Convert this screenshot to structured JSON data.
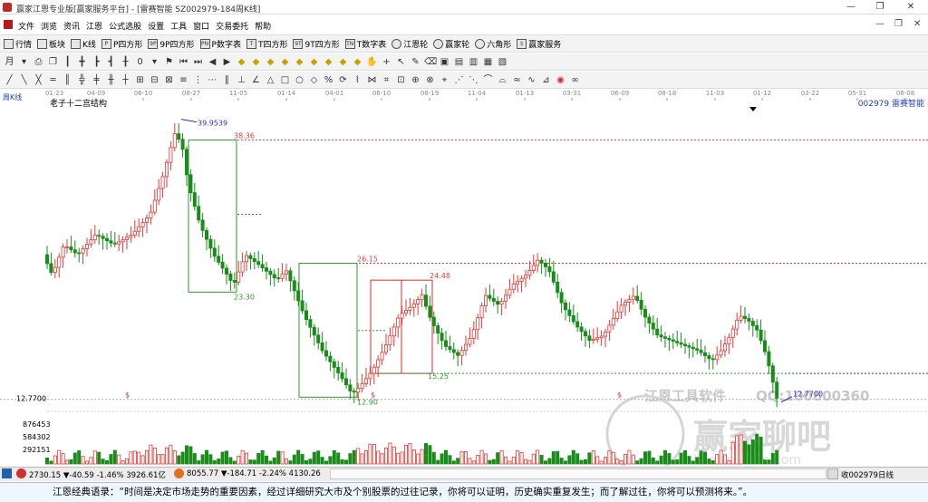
{
  "window": {
    "title": "赢家江恩专业版[赢家服务平台] - [雷赛智能  SZ002979-184周K线]",
    "buttons": [
      "—",
      "❐",
      "✕"
    ]
  },
  "menu": [
    "文件",
    "浏览",
    "资讯",
    "江恩",
    "公式选股",
    "设置",
    "工具",
    "窗口",
    "交易委托",
    "帮助"
  ],
  "mdi_buttons": [
    "—",
    "❐",
    "✕"
  ],
  "toolbar": [
    {
      "icon": "list-icon",
      "label": "行情"
    },
    {
      "icon": "grid-icon",
      "label": "板块"
    },
    {
      "icon": "candle-icon",
      "label": "K线"
    },
    {
      "icon": "square-icon",
      "label": "P四方形",
      "tag": "P"
    },
    {
      "icon": "square-icon",
      "label": "9P四方形",
      "tag": "9P"
    },
    {
      "icon": "square-icon",
      "label": "P数字表",
      "tag": "PN"
    },
    {
      "icon": "square-icon",
      "label": "T四方形",
      "tag": "T"
    },
    {
      "icon": "square-icon",
      "label": "9T四方形",
      "tag": "9T"
    },
    {
      "icon": "square-icon",
      "label": "T数字表",
      "tag": "TN"
    },
    {
      "icon": "wheel-icon",
      "label": "江恩轮"
    },
    {
      "icon": "wheel-icon",
      "label": "赢家轮"
    },
    {
      "icon": "hexagon-icon",
      "label": "六角形"
    },
    {
      "icon": "dollar-icon",
      "label": "赢家服务"
    }
  ],
  "chart": {
    "period_label": "周K线",
    "title": "老子十二宫结构",
    "stock": "002979  雷赛智能",
    "colors": {
      "up": "#e53935",
      "down": "#1b8c1b",
      "grid": "#b0b0b0",
      "box_green": "#2e9b2e",
      "box_red": "#d32f2f",
      "line_red": "#e04040",
      "line_blue": "#3030c0"
    },
    "date_ticks": [
      "01-23",
      "04-09",
      "06-10",
      "08-27",
      "11-05",
      "01-14",
      "04-01",
      "06-10",
      "08-19",
      "11-04",
      "01-13",
      "03-31",
      "06-09",
      "08-18",
      "11-03",
      "01-12",
      "03-22",
      "05-31",
      "08-08"
    ],
    "price_labels": [
      "39.9539",
      "38.36",
      "23.30",
      "26.15",
      "24.48",
      "15.25",
      "12.90",
      "12.7700"
    ],
    "left_axis": [
      "12.7700",
      "876453",
      "584302",
      "292151"
    ],
    "dollar_marker": "$",
    "watermark_tool": "江恩工具软件",
    "watermark_qq": "QQ:100800360",
    "watermark_forum": "赢家聊吧",
    "watermark_url": "liaoba.yesm.com"
  },
  "chart_data": {
    "type": "candlestick",
    "title": "老子十二宫结构",
    "key_levels": [
      39.9539,
      38.36,
      23.3,
      26.15,
      24.48,
      15.25,
      12.9,
      12.77
    ],
    "last_close": 12.77,
    "ylim": [
      12,
      42
    ]
  },
  "status": {
    "index1": "2730.15 ▼-40.59 -1.46% 3926.61亿",
    "index2": "8055.77 ▼-184.71 -2.24% 4130.26",
    "right": "收002979日线"
  },
  "footer_text": "江恩经典语录：“时间是决定市场走势的重要因素，经过详细研究大市及个别股票的过往记录，你将可以证明，历史确实重复发生；而了解过往，你将可以预测将来。”。"
}
